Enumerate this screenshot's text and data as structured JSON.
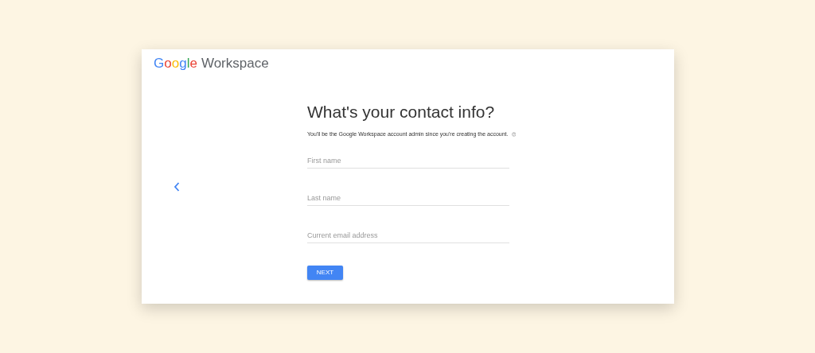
{
  "logo": {
    "brand": "Google",
    "product": "Workspace"
  },
  "heading": "What's your contact info?",
  "subtitle": "You'll be the Google Workspace account admin since you're creating the account.",
  "fields": [
    {
      "placeholder": "First name"
    },
    {
      "placeholder": "Last name"
    },
    {
      "placeholder": "Current email address"
    }
  ],
  "next_button": "NEXT"
}
